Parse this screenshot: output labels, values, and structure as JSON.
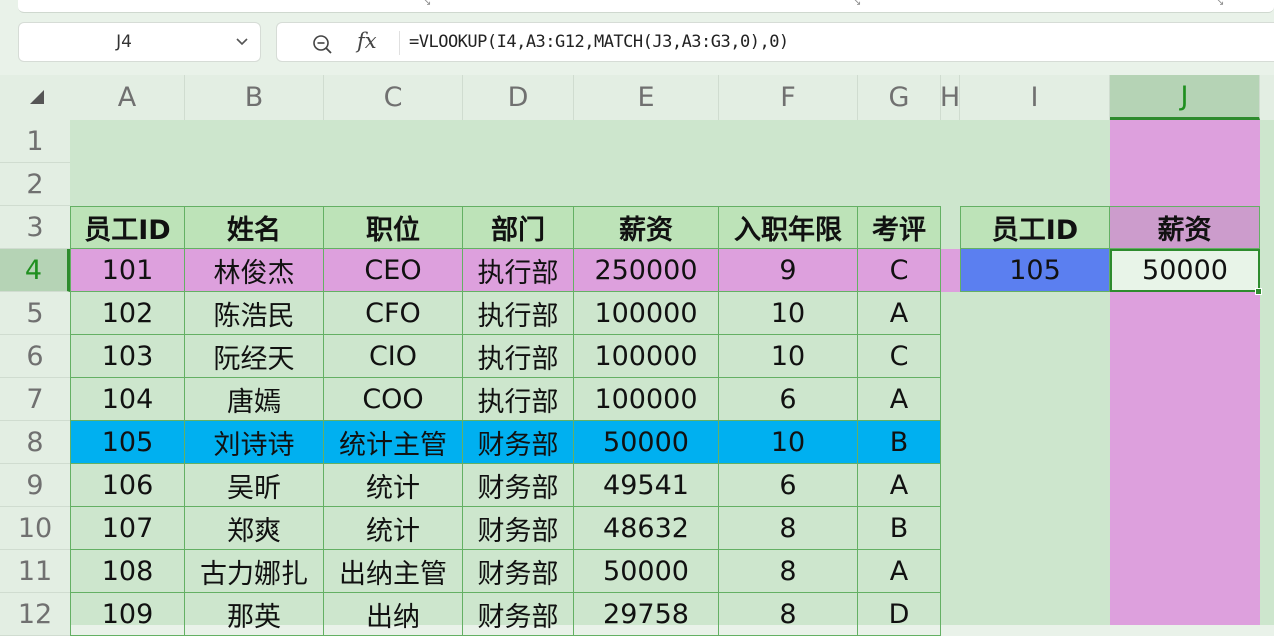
{
  "name_box": {
    "value": "J4"
  },
  "formula_bar": {
    "formula": "=VLOOKUP(I4,A3:G12,MATCH(J3,A3:G3,0),0)"
  },
  "columns": [
    "A",
    "B",
    "C",
    "D",
    "E",
    "F",
    "G",
    "H",
    "I",
    "J"
  ],
  "rows": [
    "1",
    "2",
    "3",
    "4",
    "5",
    "6",
    "7",
    "8",
    "9",
    "10",
    "11",
    "12"
  ],
  "table": {
    "headers": [
      "员工ID",
      "姓名",
      "职位",
      "部门",
      "薪资",
      "入职年限",
      "考评"
    ],
    "data": [
      [
        "101",
        "林俊杰",
        "CEO",
        "执行部",
        "250000",
        "9",
        "C"
      ],
      [
        "102",
        "陈浩民",
        "CFO",
        "执行部",
        "100000",
        "10",
        "A"
      ],
      [
        "103",
        "阮经天",
        "CIO",
        "执行部",
        "100000",
        "10",
        "C"
      ],
      [
        "104",
        "唐嫣",
        "COO",
        "执行部",
        "100000",
        "6",
        "A"
      ],
      [
        "105",
        "刘诗诗",
        "统计主管",
        "财务部",
        "50000",
        "10",
        "B"
      ],
      [
        "106",
        "吴昕",
        "统计",
        "财务部",
        "49541",
        "6",
        "A"
      ],
      [
        "107",
        "郑爽",
        "统计",
        "财务部",
        "48632",
        "8",
        "B"
      ],
      [
        "108",
        "古力娜扎",
        "出纳主管",
        "财务部",
        "50000",
        "8",
        "A"
      ],
      [
        "109",
        "那英",
        "出纳",
        "财务部",
        "29758",
        "8",
        "D"
      ]
    ]
  },
  "lookup": {
    "headers": [
      "员工ID",
      "薪资"
    ],
    "values": [
      "105",
      "50000"
    ]
  },
  "colors": {
    "sheet_bg": "#cde6cd",
    "header_row": "#bde3b8",
    "highlight_row4": "#dda0dd",
    "highlight_row8": "#00b0f0",
    "lookup_id_fill": "#5b7ff0",
    "grid_line": "#64b064",
    "selected_border": "#2e8b2e",
    "col_j_header": "#b5d3b5"
  }
}
